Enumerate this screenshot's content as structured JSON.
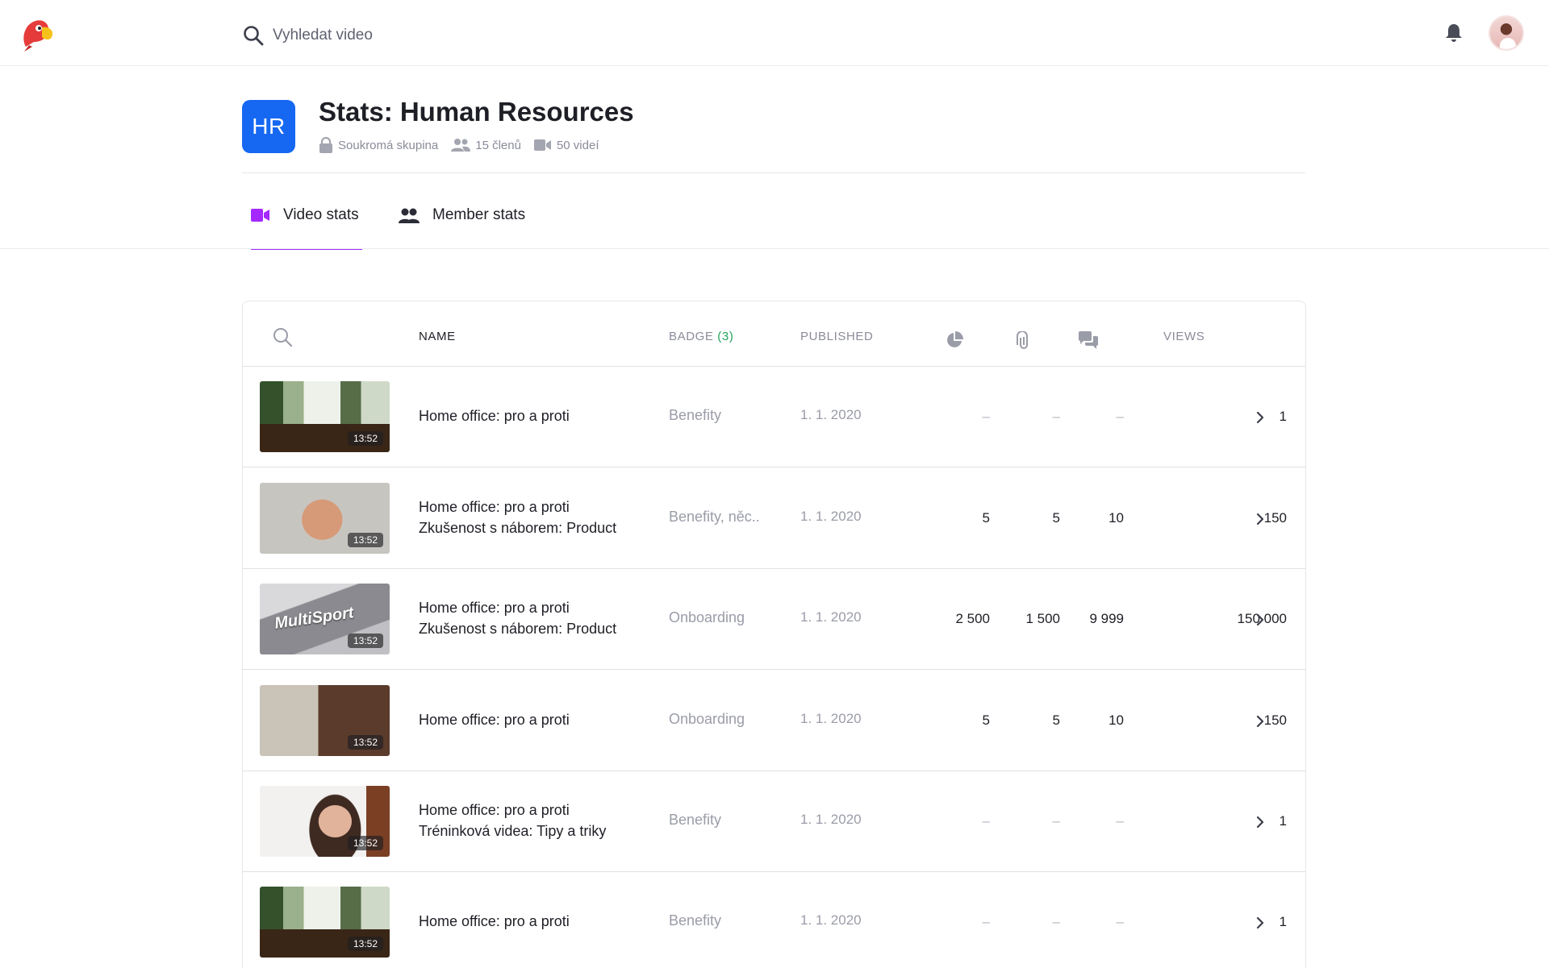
{
  "topbar": {
    "search_placeholder": "Vyhledat video",
    "icons": {
      "logo": "parrot-logo",
      "search": "search-icon",
      "notifications": "bell-icon",
      "user": "avatar"
    }
  },
  "group": {
    "initials": "HR",
    "title": "Stats: Human Resources",
    "privacy": "Soukromá skupina",
    "members": "15 členů",
    "videos": "50 videí",
    "accent_color": "#1668f2"
  },
  "tabs": [
    {
      "label": "Video stats",
      "icon": "video-icon",
      "active": true,
      "accent": "#a428ff"
    },
    {
      "label": "Member stats",
      "icon": "people-icon",
      "active": false
    }
  ],
  "table": {
    "columns": {
      "name": "NAME",
      "badge": "BADGE",
      "badge_count": "(3)",
      "published": "PUBLISHED",
      "progress_icon": "pie-chart-icon",
      "attachments_icon": "paperclip-icon",
      "comments_icon": "comments-icon",
      "views": "VIEWS"
    },
    "rows": [
      {
        "duration": "13:52",
        "line1": "Home office: pro a proti",
        "line2": "",
        "badge": "Benefity",
        "published": "1. 1. 2020",
        "progress": "–",
        "attachments": "–",
        "comments": "–",
        "views": "1"
      },
      {
        "duration": "13:52",
        "line1": "Home office: pro a proti",
        "line2": "Zkušenost s náborem: Product",
        "badge": "Benefity, něc..",
        "published": "1. 1. 2020",
        "progress": "5",
        "attachments": "5",
        "comments": "10",
        "views": "150"
      },
      {
        "duration": "13:52",
        "line1": "Home office: pro a proti",
        "line2": "Zkušenost s náborem: Product",
        "badge": "Onboarding",
        "published": "1. 1. 2020",
        "progress": "2 500",
        "attachments": "1 500",
        "comments": "9 999",
        "views": "150 000",
        "thumb_text": "MultiSport"
      },
      {
        "duration": "13:52",
        "line1": "Home office: pro a proti",
        "line2": "",
        "badge": "Onboarding",
        "published": "1. 1. 2020",
        "progress": "5",
        "attachments": "5",
        "comments": "10",
        "views": "150"
      },
      {
        "duration": "13:52",
        "line1": "Home office: pro a proti",
        "line2": "Tréninková videa: Tipy a triky",
        "badge": "Benefity",
        "published": "1. 1. 2020",
        "progress": "–",
        "attachments": "–",
        "comments": "–",
        "views": "1"
      },
      {
        "duration": "13:52",
        "line1": "Home office: pro a proti",
        "line2": "",
        "badge": "Benefity",
        "published": "1. 1. 2020",
        "progress": "–",
        "attachments": "–",
        "comments": "–",
        "views": "1"
      }
    ]
  }
}
